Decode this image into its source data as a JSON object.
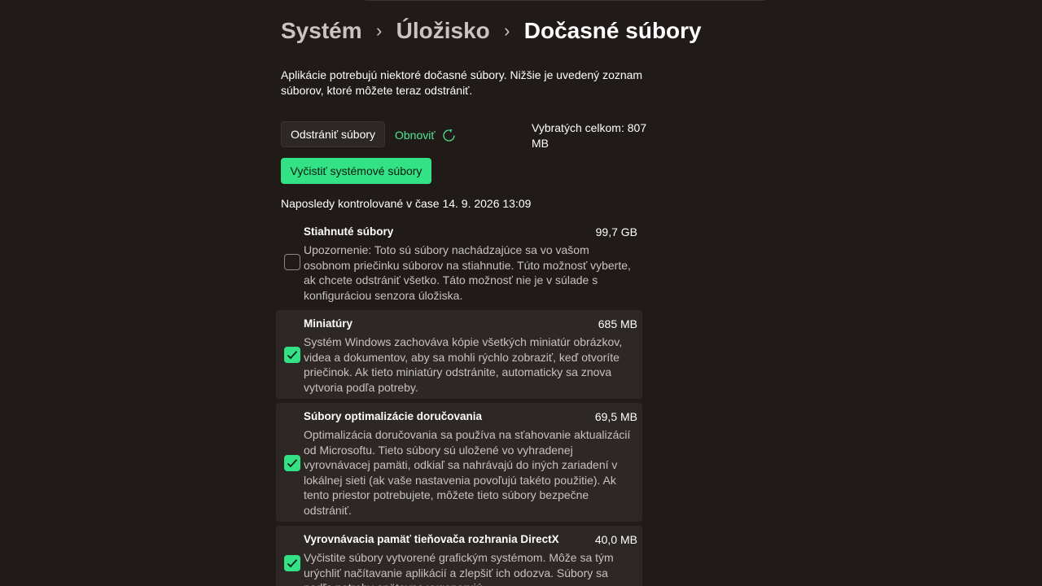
{
  "breadcrumb": {
    "items": [
      "Systém",
      "Úložisko"
    ],
    "current": "Dočasné súbory"
  },
  "description": "Aplikácie potrebujú niektoré dočasné súbory. Nižšie je uvedený zoznam súborov, ktoré môžete teraz odstrániť.",
  "actions": {
    "remove_label": "Odstrániť súbory",
    "refresh_label": "Obnoviť",
    "total_label": "Vybratých celkom: 807 MB",
    "clean_system_label": "Vyčistiť systémové súbory"
  },
  "last_checked": "Naposledy kontrolované v čase 14. 9. 2026 13:09",
  "colors": {
    "accent": "#33e284",
    "background": "#201b19",
    "card": "#2d2826"
  },
  "items": [
    {
      "title": "Stiahnuté súbory",
      "size": "99,7 GB",
      "checked": false,
      "description": "Upozornenie: Toto sú súbory nachádzajúce sa vo vašom osobnom priečinku súborov na stiahnutie. Túto možnosť vyberte, ak chcete odstrániť všetko. Táto možnosť nie je v súlade s konfiguráciou senzora úložiska."
    },
    {
      "title": "Miniatúry",
      "size": "685 MB",
      "checked": true,
      "description": "Systém Windows zachováva kópie všetkých miniatúr obrázkov, videa a dokumentov, aby sa mohli rýchlo zobraziť, keď otvoríte priečinok. Ak tieto miniatúry odstránite, automaticky sa znova vytvoria podľa potreby."
    },
    {
      "title": "Súbory optimalizácie doručovania",
      "size": "69,5 MB",
      "checked": true,
      "description": "Optimalizácia doručovania sa používa na sťahovanie aktualizácií od Microsoftu. Tieto súbory sú uložené vo vyhradenej vyrovnávacej pamäti, odkiaľ sa nahrávajú do iných zariadení v lokálnej sieti (ak vaše nastavenia povoľujú takéto použitie). Ak tento priestor potrebujete, môžete tieto súbory bezpečne odstrániť."
    },
    {
      "title": "Vyrovnávacia pamäť tieňovača rozhrania DirectX",
      "size": "40,0 MB",
      "checked": true,
      "description": "Vyčistite súbory vytvorené grafickým systémom. Môže sa tým urýchliť načítavanie aplikácií a zlepšiť ich odozva. Súbory sa podľa potreby opätovne vygenerujú."
    }
  ]
}
